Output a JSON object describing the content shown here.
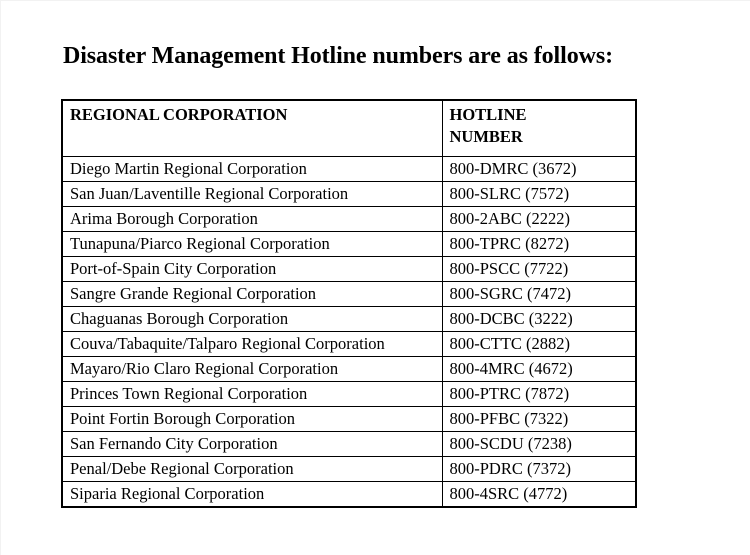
{
  "document": {
    "title": "Disaster Management Hotline numbers are as follows:"
  },
  "table": {
    "headers": {
      "corporation": "REGIONAL CORPORATION",
      "hotline_line1": "HOTLINE",
      "hotline_line2": "NUMBER"
    },
    "rows": [
      {
        "corporation": "Diego Martin Regional Corporation",
        "hotline": "800-DMRC (3672)"
      },
      {
        "corporation": "San Juan/Laventille Regional Corporation",
        "hotline": "800-SLRC (7572)"
      },
      {
        "corporation": "Arima Borough Corporation",
        "hotline": "800-2ABC (2222)"
      },
      {
        "corporation": "Tunapuna/Piarco Regional Corporation",
        "hotline": "800-TPRC (8272)"
      },
      {
        "corporation": "Port-of-Spain City Corporation",
        "hotline": "800-PSCC (7722)"
      },
      {
        "corporation": "Sangre Grande Regional Corporation",
        "hotline": "800-SGRC (7472)"
      },
      {
        "corporation": "Chaguanas Borough Corporation",
        "hotline": "800-DCBC (3222)"
      },
      {
        "corporation": "Couva/Tabaquite/Talparo Regional Corporation",
        "hotline": "800-CTTC (2882)"
      },
      {
        "corporation": "Mayaro/Rio Claro Regional Corporation",
        "hotline": "800-4MRC (4672)"
      },
      {
        "corporation": "Princes Town Regional Corporation",
        "hotline": "800-PTRC (7872)"
      },
      {
        "corporation": "Point Fortin Borough Corporation",
        "hotline": "800-PFBC (7322)"
      },
      {
        "corporation": "San Fernando City Corporation",
        "hotline": "800-SCDU (7238)"
      },
      {
        "corporation": "Penal/Debe Regional Corporation",
        "hotline": "800-PDRC (7372)"
      },
      {
        "corporation": "Siparia Regional Corporation",
        "hotline": "800-4SRC (4772)"
      }
    ]
  },
  "colors": {
    "text": "#000000",
    "background": "#ffffff",
    "border": "#000000"
  }
}
